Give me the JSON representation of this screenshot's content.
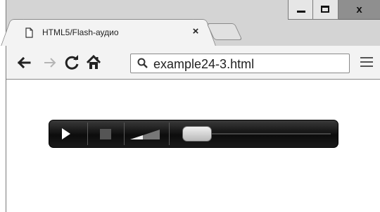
{
  "tab": {
    "title": "HTML5/Flash-аудио",
    "close_label": "×",
    "page_icon": "page-icon"
  },
  "window_controls": {
    "minimize_icon": "minimize-icon",
    "maximize_icon": "maximize-icon",
    "close_label": "x"
  },
  "toolbar": {
    "back_icon": "back-arrow-icon",
    "forward_icon": "forward-arrow-icon",
    "reload_icon": "reload-icon",
    "home_icon": "home-icon",
    "search_icon": "search-icon",
    "url": "example24-3.html",
    "menu_icon": "hamburger-menu-icon"
  },
  "player": {
    "play_icon": "play-icon",
    "stop_icon": "stop-icon",
    "volume_icon": "volume-icon",
    "seek_position": 0
  }
}
